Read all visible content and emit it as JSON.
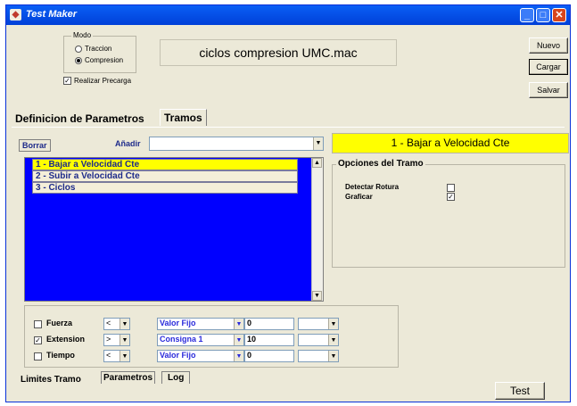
{
  "window": {
    "title": "Test Maker",
    "app_icon": "test-maker-icon"
  },
  "modo": {
    "legend": "Modo",
    "options": [
      {
        "label": "Traccion",
        "selected": false
      },
      {
        "label": "Compresion",
        "selected": true
      }
    ]
  },
  "precarga": {
    "label": "Realizar Precarga",
    "checked": true
  },
  "file": {
    "name": "ciclos compresion UMC.mac"
  },
  "file_buttons": {
    "nuevo": "Nuevo",
    "cargar": "Cargar",
    "salvar": "Salvar"
  },
  "tabs": {
    "definicion": "Definicion de Parametros",
    "tramos": "Tramos"
  },
  "toolbar": {
    "borrar": "Borrar",
    "anadir": "Añadir",
    "anadir_value": ""
  },
  "tramos_list": [
    {
      "label": "1 - Bajar a Velocidad Cte",
      "selected": true
    },
    {
      "label": "2 - Subir a Velocidad Cte",
      "selected": false
    },
    {
      "label": "3 - Ciclos",
      "selected": false
    }
  ],
  "selected_tramo": {
    "title": "1 - Bajar a Velocidad Cte"
  },
  "opciones": {
    "legend": "Opciones del Tramo",
    "items": [
      {
        "label": "Detectar Rotura",
        "checked": false
      },
      {
        "label": "Graficar",
        "checked": true
      }
    ]
  },
  "limits": [
    {
      "label": "Fuerza",
      "checked": false,
      "op": "<",
      "mode": "Valor Fijo",
      "value": "0",
      "extra": ""
    },
    {
      "label": "Extension",
      "checked": true,
      "op": ">",
      "mode": "Consigna 1",
      "value": "10",
      "extra": ""
    },
    {
      "label": "Tiempo",
      "checked": false,
      "op": "<",
      "mode": "Valor Fijo",
      "value": "0",
      "extra": ""
    }
  ],
  "bottom_tabs": {
    "limites": "Limites Tramo",
    "parametros": "Parametros",
    "log": "Log"
  },
  "test_button": "Test",
  "colors": {
    "titlebar": "#0a5ff5",
    "list_bg": "#0000ff",
    "highlight": "#ffff00",
    "window_bg": "#ece9d8"
  }
}
